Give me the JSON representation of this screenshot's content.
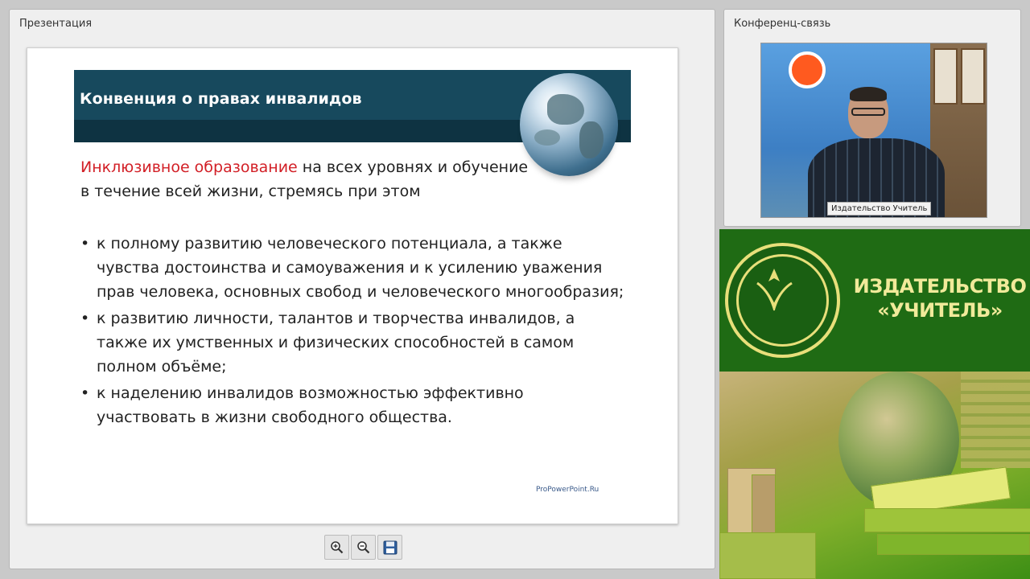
{
  "presentation": {
    "panel_title": "Презентация",
    "slide": {
      "header": "Конвенция о правах инвалидов",
      "intro_highlight": "Инклюзивное образование",
      "intro_rest": " на всех уровнях и обучение в течение всей жизни, стремясь при этом",
      "bullets": [
        "к полному развитию человеческого потенциала, а также чувства достоинства и самоуважения и к усилению уважения прав человека, основных свобод и человеческого многообразия;",
        "к развитию личности, талантов и творчества инвалидов, а также их умственных и физических способностей в самом полном объёме;",
        "к наделению инвалидов возможностью эффективно участвовать в жизни свободного общества."
      ],
      "watermark": "ProPowerPoint.Ru",
      "colors": {
        "header_bg": "#17495d",
        "highlight": "#d21f26"
      }
    },
    "toolbar": {
      "zoom_in_icon": "zoom-in-icon",
      "zoom_out_icon": "zoom-out-icon",
      "save_icon": "save-icon"
    }
  },
  "conference": {
    "panel_title": "Конференц-связь",
    "video_caption": "Издательство Учитель"
  },
  "publisher": {
    "line1": "ИЗДАТЕЛЬСТВО",
    "line2": "«УЧИТЕЛЬ»",
    "colors": {
      "bg": "#1f6b14",
      "text": "#f1ea9a"
    }
  }
}
